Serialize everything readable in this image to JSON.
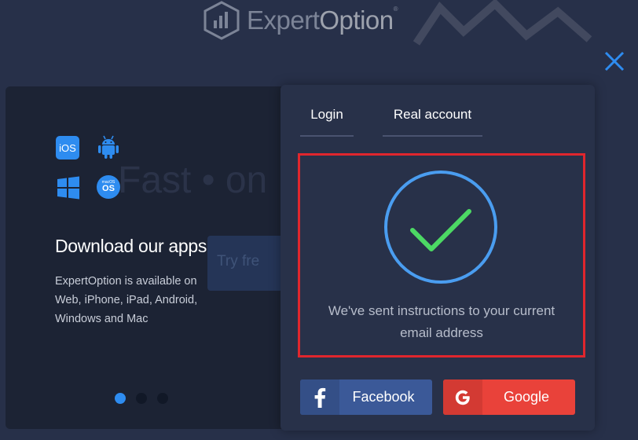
{
  "brand": {
    "name_part1": "Expert",
    "name_part2": "Option",
    "trademark": "®"
  },
  "background": {
    "ghost_headline": "Fast • on",
    "ghost_button": "Try fre"
  },
  "slide": {
    "title": "Download our apps",
    "description": "ExpertOption is available on Web, iPhone, iPad, Android, Windows and Mac",
    "apps": {
      "ios_label": "iOS",
      "macos_small": "macOS",
      "macos_big": "OS"
    },
    "dots": [
      {
        "active": true
      },
      {
        "active": false
      },
      {
        "active": false
      }
    ]
  },
  "tabs": {
    "login": "Login",
    "real_account": "Real account"
  },
  "success": {
    "line1": "We've sent instructions to your current",
    "line2": "email address"
  },
  "social": {
    "facebook": "Facebook",
    "google": "Google",
    "facebook_icon": "f",
    "google_icon": "G"
  },
  "colors": {
    "accent_blue": "#2e8cf0",
    "check_green": "#4cd964",
    "highlight_red": "#e0262d",
    "facebook": "#3b5998",
    "google": "#e9423a"
  }
}
